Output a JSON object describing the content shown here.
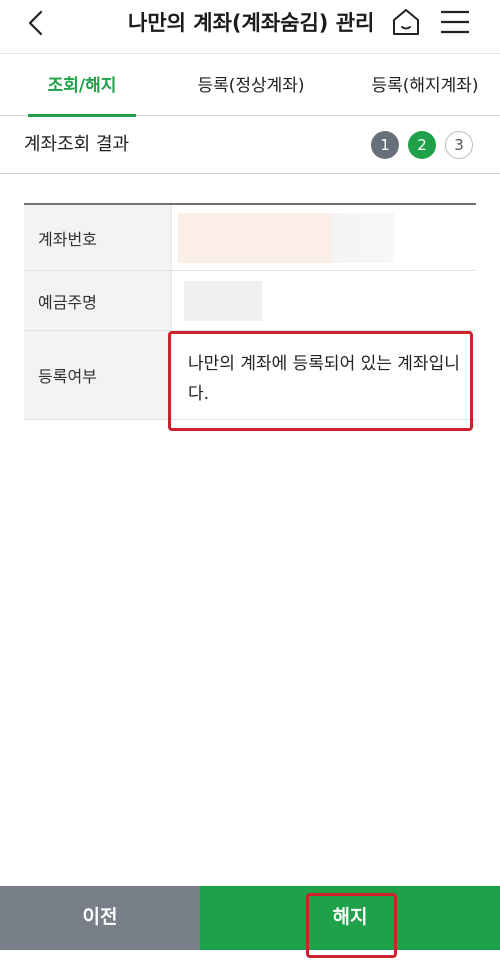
{
  "header": {
    "title": "나만의 계좌(계좌숨김) 관리",
    "back_icon": "chevron-left-icon",
    "home_icon": "home-icon",
    "menu_icon": "hamburger-menu-icon"
  },
  "tabs": [
    {
      "label": "조회/해지",
      "active": true
    },
    {
      "label": "등록(정상계좌)",
      "active": false
    },
    {
      "label": "등록(해지계좌)",
      "active": false
    }
  ],
  "section": {
    "title": "계좌조회 결과",
    "steps": [
      "1",
      "2",
      "3"
    ],
    "current_step": 2
  },
  "table": {
    "rows": [
      {
        "label": "계좌번호",
        "value": ""
      },
      {
        "label": "예금주명",
        "value": ""
      },
      {
        "label": "등록여부",
        "value": "나만의 계좌에 등록되어 있는 계좌입니다."
      }
    ]
  },
  "footer": {
    "prev_label": "이전",
    "cancel_label": "해지"
  },
  "colors": {
    "accent": "#1fa14a",
    "step_done": "#67707a",
    "prev_button": "#787f89",
    "highlight": "#d0202e"
  }
}
